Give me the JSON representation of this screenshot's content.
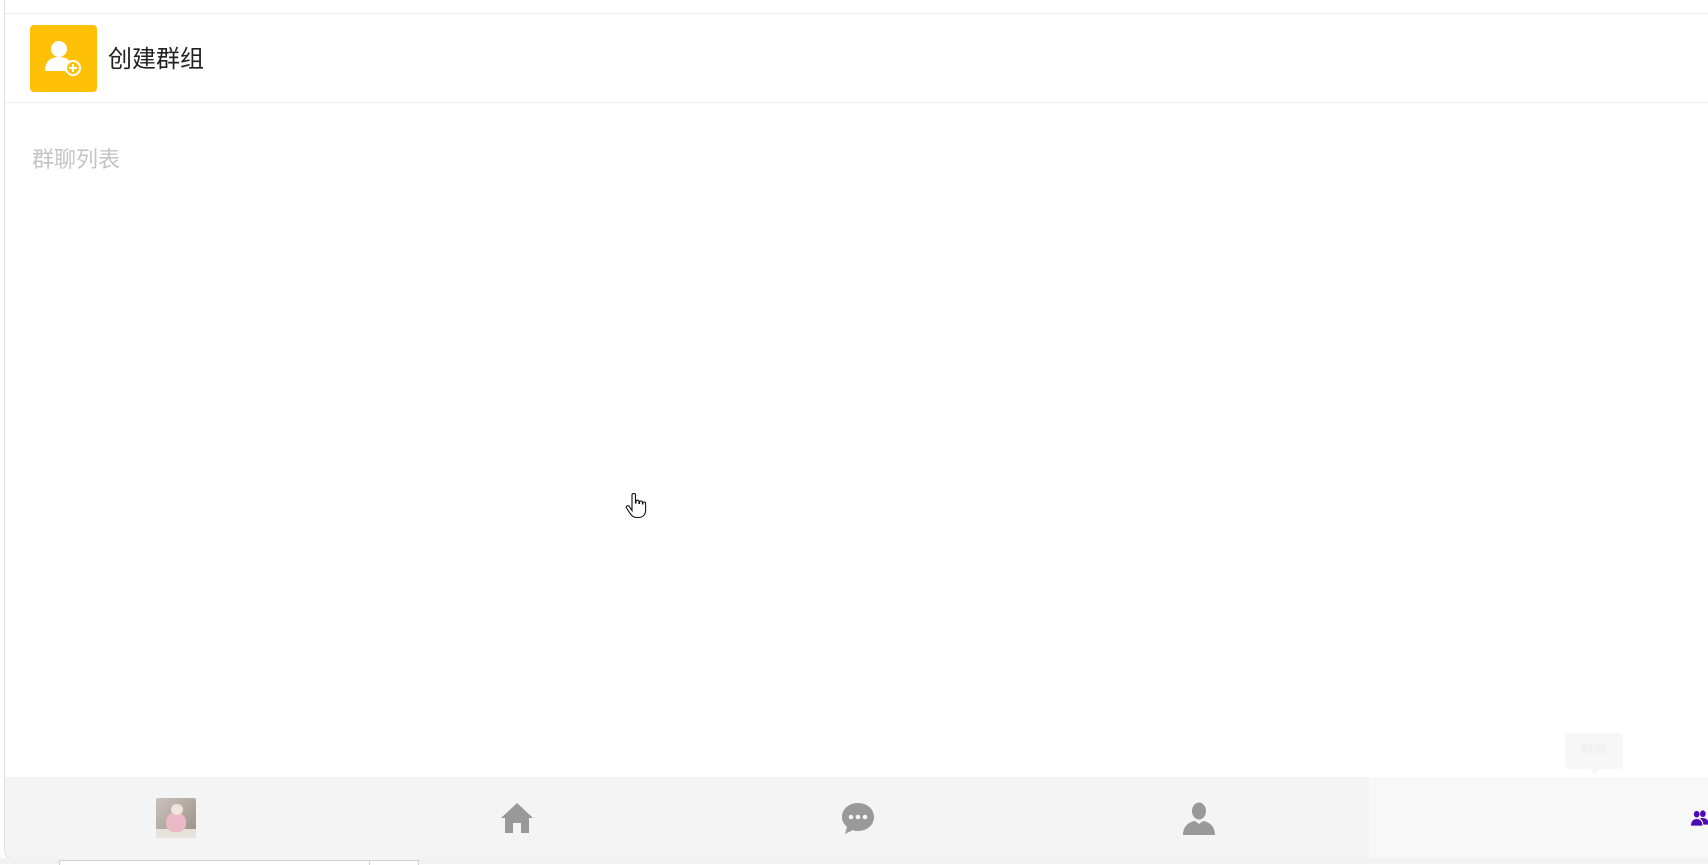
{
  "create_group": {
    "label": "创建群组",
    "icon": "add-user-icon",
    "icon_bg": "#ffc107"
  },
  "group_list": {
    "label": "群聊列表"
  },
  "tooltip": {
    "label": "群聊"
  },
  "bottom_nav": {
    "items": [
      {
        "name": "avatar",
        "icon": "user-avatar-photo"
      },
      {
        "name": "home",
        "icon": "home-icon"
      },
      {
        "name": "chat",
        "icon": "chat-bubble-icon"
      },
      {
        "name": "contacts",
        "icon": "person-icon"
      },
      {
        "name": "groups",
        "icon": "group-icon",
        "active": true
      }
    ],
    "icon_color": "#999999",
    "active_color": "#4b0bb5"
  }
}
